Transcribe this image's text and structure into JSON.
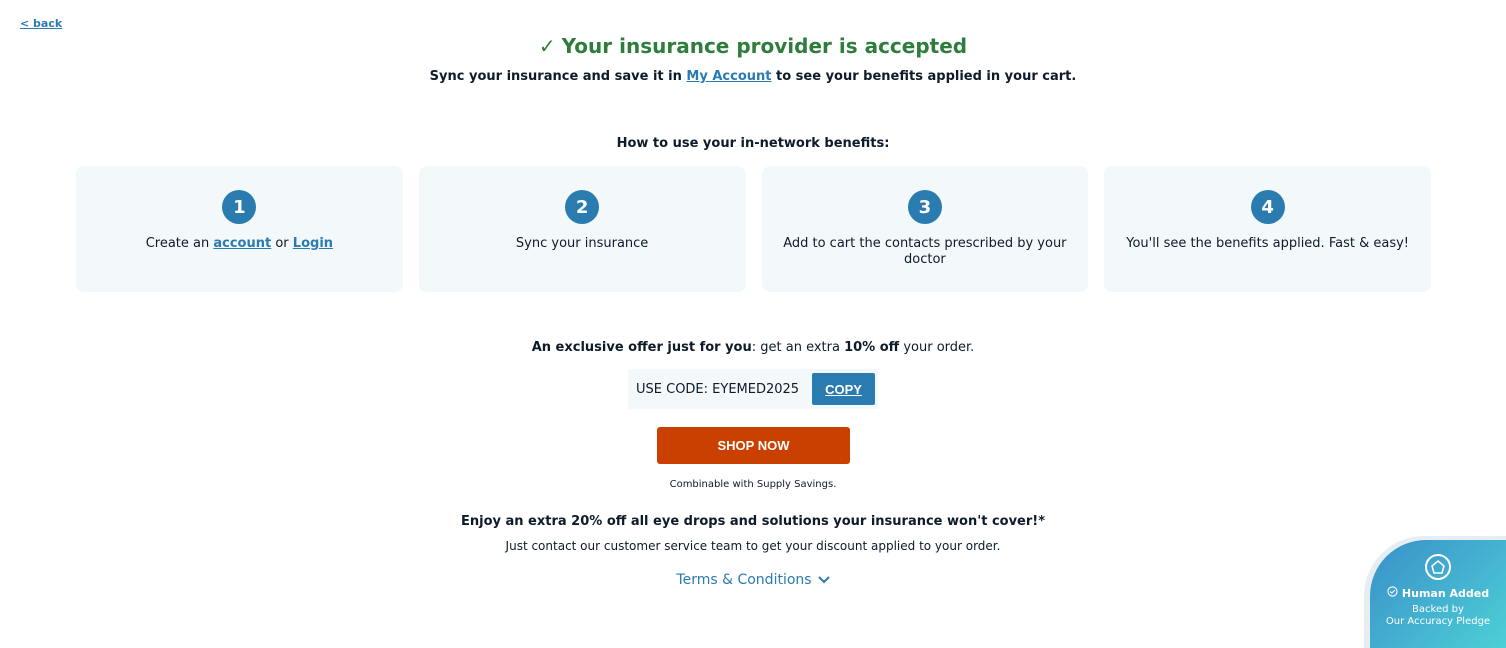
{
  "nav": {
    "back_label": "< back"
  },
  "header": {
    "title": "Your insurance provider is accepted",
    "sub_prefix": "Sync your insurance and save it in ",
    "sub_link": "My Account",
    "sub_suffix": " to see your benefits applied in your cart."
  },
  "steps": {
    "title": "How to use your in-network benefits:",
    "items": [
      {
        "number": "1",
        "prefix": "Create an ",
        "link1": "account",
        "middle": " or ",
        "link2": "Login"
      },
      {
        "number": "2",
        "text": "Sync your insurance"
      },
      {
        "number": "3",
        "text": "Add to cart the contacts prescribed by your doctor"
      },
      {
        "number": "4",
        "text": "You'll see the benefits applied. Fast & easy!"
      }
    ]
  },
  "offer": {
    "bold1": "An exclusive offer just for you",
    "mid": ": get an extra ",
    "bold2": "10% off",
    "end": " your order.",
    "code_label": "USE CODE: EYEMED2025",
    "copy_label": "COPY",
    "shop_label": "SHOP NOW",
    "combinable": "Combinable with Supply Savings."
  },
  "extra": {
    "headline": "Enjoy an extra 20% off all eye drops and solutions your insurance won't cover!*",
    "contact": "Just contact our customer service team to get your discount applied to your order.",
    "terms_label": "Terms & Conditions"
  },
  "badge": {
    "title": "Human Added",
    "line1": "Backed by",
    "line2": "Our Accuracy Pledge"
  },
  "colors": {
    "accent": "#2a7bb0",
    "success": "#2e7d3c",
    "cta": "#c94000",
    "card_bg": "#f3f8fb"
  }
}
